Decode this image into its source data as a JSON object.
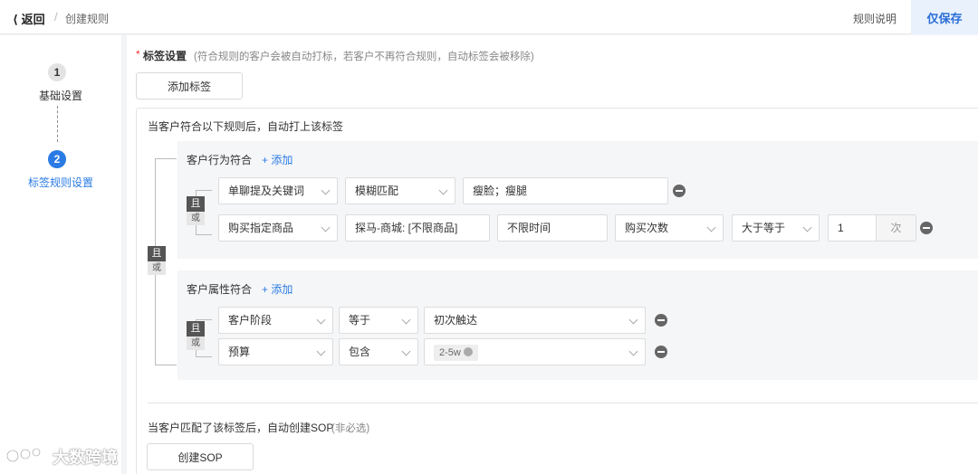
{
  "header": {
    "back_label": "返回",
    "separator": "/",
    "breadcrumb": "创建规则",
    "help_link": "规则说明",
    "save_label": "仅保存"
  },
  "steps": [
    {
      "number": "1",
      "label": "基础设置"
    },
    {
      "number": "2",
      "label": "标签规则设置"
    }
  ],
  "tag_section": {
    "required_mark": "*",
    "title": "标签设置",
    "hint": "(符合规则的客户会被自动打标，若客户不再符合规则，自动标签会被移除)",
    "add_tag_label": "添加标签",
    "rule_desc": "当客户符合以下规则后，自动打上该标签"
  },
  "logic": {
    "and": "且",
    "or": "或"
  },
  "behavior_group": {
    "title": "客户行为符合",
    "add_label": "+ 添加",
    "row1": {
      "type": "单聊提及关键词",
      "match": "模糊匹配",
      "keywords": "瘦脸；瘦腿"
    },
    "row2": {
      "type": "购买指定商品",
      "product": "探马-商城: [不限商品]",
      "time": "不限时间",
      "metric": "购买次数",
      "operator": "大于等于",
      "value": "1",
      "unit": "次"
    }
  },
  "attribute_group": {
    "title": "客户属性符合",
    "add_label": "+ 添加",
    "row1": {
      "attr": "客户阶段",
      "operator": "等于",
      "value": "初次触达"
    },
    "row2": {
      "attr": "预算",
      "operator": "包含",
      "chip": "2-5w"
    }
  },
  "sop_section": {
    "desc": "当客户匹配了该标签后，自动创建SOP",
    "hint": "(非必选)",
    "button_label": "创建SOP"
  },
  "watermark": {
    "logo_text": "大数跨境"
  }
}
